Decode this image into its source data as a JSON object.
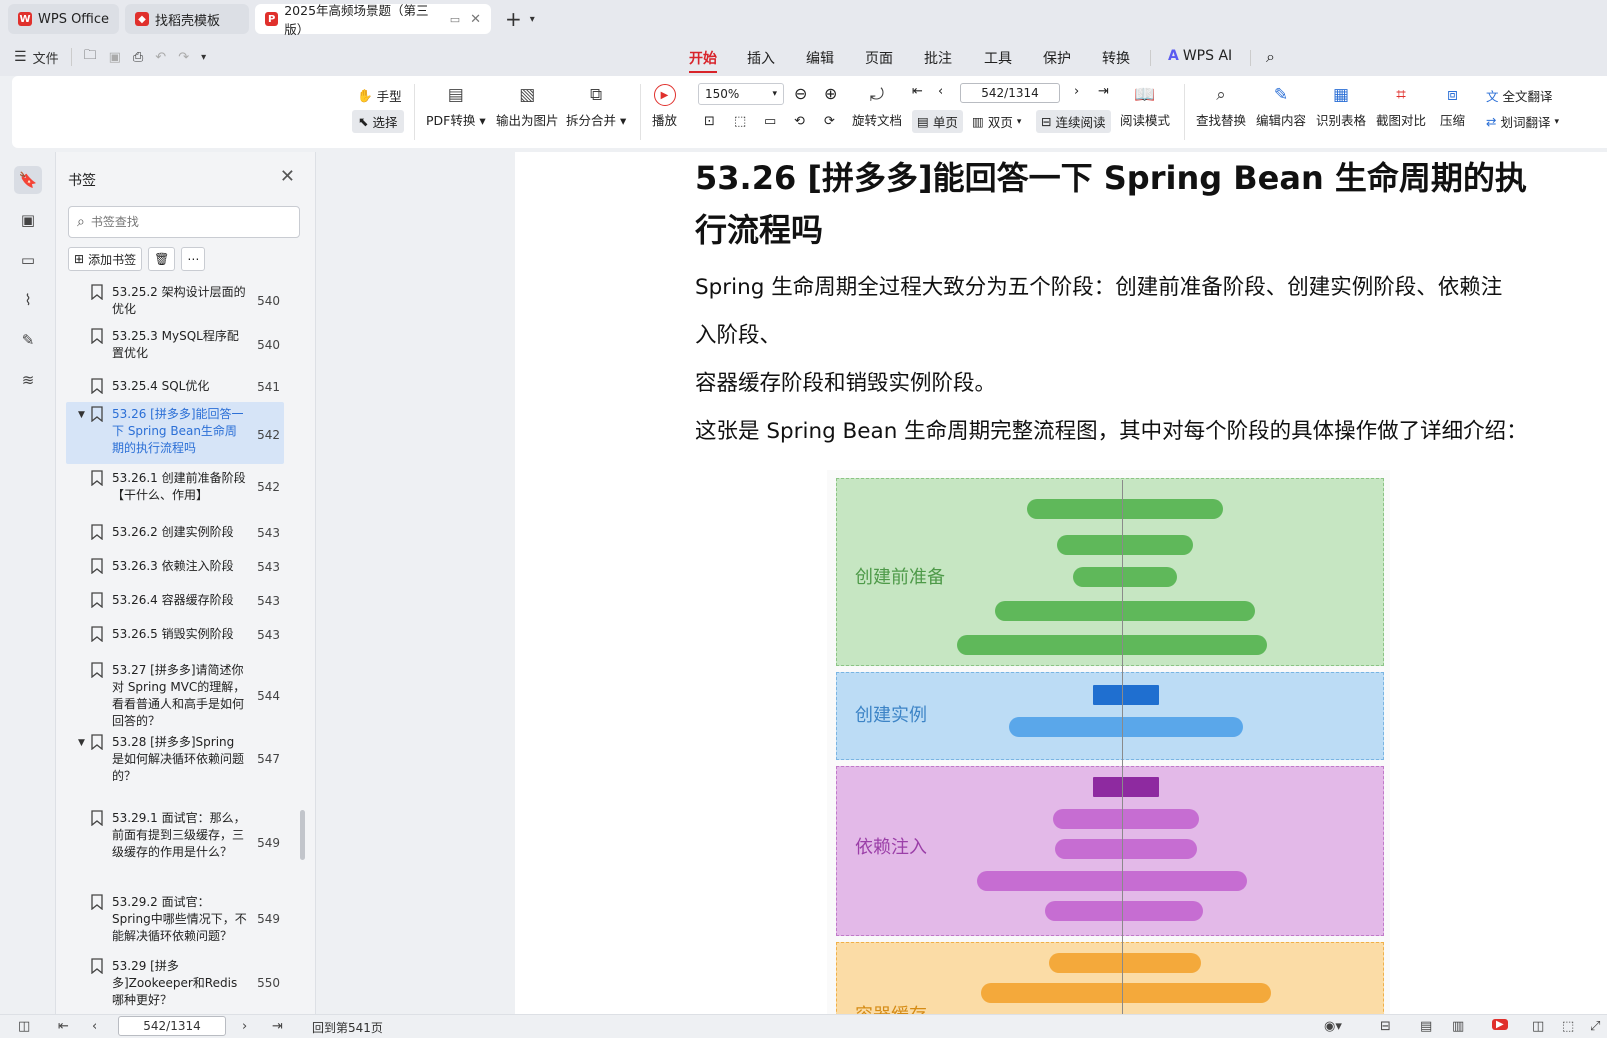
{
  "tabs": [
    {
      "label": "WPS Office",
      "icon": "wps-logo-icon"
    },
    {
      "label": "找稻壳模板",
      "icon": "docer-icon"
    },
    {
      "label": "2025年高频场景题（第三版）",
      "icon": "pdf-icon"
    }
  ],
  "menu": {
    "file_label": "文件",
    "items": [
      "开始",
      "插入",
      "编辑",
      "页面",
      "批注",
      "工具",
      "保护",
      "转换"
    ],
    "active": "开始",
    "ai_label": "WPS AI"
  },
  "ribbon": {
    "hand_label": "手型",
    "select_label": "选择",
    "pdf_convert": "PDF转换",
    "export_image": "输出为图片",
    "split_merge": "拆分合并",
    "play": "播放",
    "zoom": "150%",
    "rotate_doc": "旋转文档",
    "page_field": "542/1314",
    "single_page": "单页",
    "double_page": "双页",
    "continuous": "连续阅读",
    "read_mode": "阅读模式",
    "find_replace": "查找替换",
    "edit_content": "编辑内容",
    "recognize_table": "识别表格",
    "screenshot_compare": "截图对比",
    "compress": "压缩",
    "full_translate": "全文翻译",
    "word_translate": "划词翻译"
  },
  "bookmark_panel": {
    "title": "书签",
    "search_placeholder": "书签查找",
    "add_bookmark": "添加书签",
    "items": [
      {
        "text": "53.25.2 架构设计层面的优化",
        "page": "540",
        "indent": 2
      },
      {
        "text": "53.25.3 MySQL程序配置优化",
        "page": "540",
        "indent": 2
      },
      {
        "text": "53.25.4 SQL优化",
        "page": "541",
        "indent": 2
      },
      {
        "text": "53.26 [拼多多]能回答一下 Spring Bean生命周期的执行流程吗",
        "page": "542",
        "indent": 1,
        "selected": true,
        "expanded": true
      },
      {
        "text": "53.26.1 创建前准备阶段【干什么、作用】",
        "page": "542",
        "indent": 2
      },
      {
        "text": "53.26.2 创建实例阶段",
        "page": "543",
        "indent": 2
      },
      {
        "text": "53.26.3 依赖注入阶段",
        "page": "543",
        "indent": 2
      },
      {
        "text": "53.26.4 容器缓存阶段",
        "page": "543",
        "indent": 2
      },
      {
        "text": "53.26.5 销毁实例阶段",
        "page": "543",
        "indent": 2
      },
      {
        "text": "53.27 [拼多多]请简述你对 Spring MVC的理解，看看普通人和高手是如何回答的？",
        "page": "544",
        "indent": 1
      },
      {
        "text": "53.28 [拼多多]Spring 是如何解决循环依赖问题的？",
        "page": "547",
        "indent": 1,
        "expanded": true
      },
      {
        "text": "53.29.1 面试官：那么，前面有提到三级缓存，三级缓存的作用是什么？",
        "page": "549",
        "indent": 2
      },
      {
        "text": "53.29.2 面试官：Spring中哪些情况下，不能解决循环依赖问题？",
        "page": "549",
        "indent": 2
      },
      {
        "text": "53.29 [拼多多]Zookeeper和Redis哪种更好？",
        "page": "550",
        "indent": 1
      }
    ]
  },
  "document": {
    "heading": "53.26 [拼多多]能回答一下 Spring Bean 生命周期的执行流程吗",
    "para1": "Spring 生命周期全过程大致分为五个阶段：创建前准备阶段、创建实例阶段、依赖注",
    "para2": "入阶段、",
    "para3": "容器缓存阶段和销毁实例阶段。",
    "para4": "这张是 Spring Bean 生命周期完整流程图，其中对每个阶段的具体操作做了详细介绍：",
    "figure_stages": [
      "创建前准备",
      "创建实例",
      "依赖注入",
      "容器缓存"
    ]
  },
  "statusbar": {
    "page_field": "542/1314",
    "back_label": "回到第541页"
  },
  "colors": {
    "accent": "#d8232a",
    "selected_bookmark": "#d6e4f7",
    "stage_green": "#c6e6c2",
    "stage_blue": "#bcdcf5",
    "stage_purple": "#e3b9e8",
    "stage_orange": "#fbdca6"
  }
}
